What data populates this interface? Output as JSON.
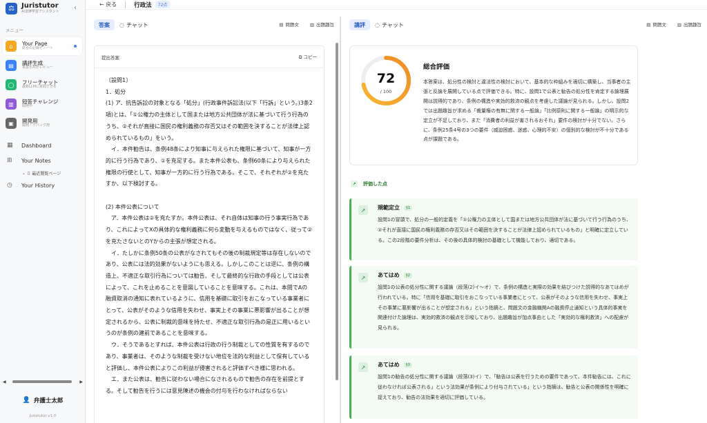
{
  "sidebar": {
    "brand": {
      "name": "Juristutor",
      "subtitle": "AI法律学習アシスタント"
    },
    "menu_label": "メニュー",
    "items": [
      {
        "title": "Your Page",
        "subtitle": "総合の記録とノート",
        "color": "#f5a623",
        "icon": "home-icon",
        "glyph": "⌂"
      },
      {
        "title": "講評生成",
        "subtitle": "答案をAIがレビュー",
        "color": "#3b82f6",
        "icon": "document-icon",
        "glyph": "▤"
      },
      {
        "title": "フリーチャット",
        "subtitle": "最新LLMに質問できる",
        "color": "#22b573",
        "icon": "chat-icon",
        "glyph": "◯"
      },
      {
        "title": "短答チャレンジ",
        "subtitle": "開発中",
        "color": "#8e5bd4",
        "icon": "book-icon",
        "glyph": "▥"
      },
      {
        "title": "開発用",
        "subtitle": "開発・デバッグ用",
        "color": "#666666",
        "icon": "terminal-icon",
        "glyph": "▣"
      }
    ],
    "links": {
      "dashboard": "Dashboard",
      "notes": "Your Notes",
      "recent_page": "最近閲覧ページ",
      "history": "Your History"
    },
    "user_name": "弁護士太郎",
    "version": "Juristutor v1.0"
  },
  "topbar": {
    "back": "戻る",
    "title": "行政法",
    "badge": "72点"
  },
  "left_panel": {
    "tab_answer": "答案",
    "tab_chat": "チャット",
    "question_text": "問題文",
    "intent": "出題趣旨",
    "card_title": "提出答案",
    "copy": "コピー",
    "paragraphs": [
      "〔設問1〕",
      "1．処分",
      "(1) ア．抗告訴訟の対象となる「処分」(行政事件訴訟法(以下「行訴」という。)3条2項)とは、「①公権力の主体として国または地方公共団体が法に基づいて行う行為のうち、②それが直接に国民の権利義務の存否又はその範囲を決することが法律上認められているもの」をいう。",
      "　イ．本件勧告は、条例48条により知事に与えられた権限に基づいて、知事が一方的に行う行為であり、①を充足する。また本件公表も、条例60条により与えられた権限の行使として、知事が一方的に行う行為である。そこで、それぞれが②を充たすか、以下検討する。",
      "",
      "(2) 本件公表について",
      "　ア．本件公表は②を充たすか。本件公表は、それ自体は知事の行う事実行為であり、これによってXの具体的な権利義務に何ら変動を与えるものではなく、従って②を充たさないとのYからの主張が想定される。",
      "　イ．たしかに条例50条の公表がなされてもその後の制裁規定等は存在しないのであり、公表には法的効果がないようにも思える。しかしこのことは逆に、条例の構造上、不適正な取引行為については勧告、そして最終的な行政の手段としては公表によって、これを止めることを意図していることを意味する。これは、本問でAの融資取消の通知に表れているように、信用を基礎に取引をおこなっている事業者にとって、公表がそのような信用を失わせ、事実上その事業に悪影響が出ることが想定されるから、公表に制裁的意味を持たせ、不適正な取引行為の是正に用いるというのが条例の建前であることを意味する。",
      "　ウ．そうであるとすれば、本件公表は行政の行う制裁としての性質を有するのであり、事業者は、そのような制裁を受けない地位を法的な利益として保有していると評価し、本件公表によりこの利益が侵害されると評価すべき様に思われる。",
      "　エ．また公表は、勧告に従わない場合になされるもので勧告の存在を前提とする。そして勧告を行うには意見陳述の機会の付与を行わなければならない"
    ]
  },
  "right_panel": {
    "tab_review": "講評",
    "tab_chat": "チャット",
    "question_text": "問題文",
    "intent": "出題趣旨",
    "score": 72,
    "score_max": "/ 100",
    "summary_title": "総合評価",
    "summary_text": "本答案は、処分性の検討と違法性の検討において、基本的な枠組みを適切に構築し、当事者の主張と反論を展開している点で評価できる。特に、設問1で公表と勧告の処分性を肯定する論理展開は説得的であり、条例の構造や実効的救済の観点を考慮した議論が見られる。しかし、設問2では出題趣旨が求める「裁量権の有無に関する一般論」「比例原則に関する一般論」の明示的な定立が不足しており、また「消費者の利益が害されるおそれ」要件の検討が十分でない。さらに、条例25条4号の3つの要件（威迫困惑、迷惑、心理的不安）の個別的な検討が不十分である点が課題である。",
    "good_heading": "評価した点",
    "good_points": [
      {
        "title": "規範定立",
        "badge": "§1",
        "text": "設問1の冒頭で、処分の一般的定義を「①公権力の主体として国または地方公共団体が法に基づいて行う行為のうち、②それが直接に国民の権利義務の存否又はその範囲を決することが法律上認められているもの」と明確に定立している。この2段階の要件分析は、その後の具体的検討の基礎として機能しており、適切である。"
      },
      {
        "title": "あてはめ",
        "badge": "§2",
        "text": "設問1の公表の処分性に関する議論（段落(2)イ〜オ）で、条例の構造と実際の効果を結びつけた説得的なあてはめが行われている。特に「信用を基礎に取引をおこなっている事業者にとって、公表がそのような信用を失わせ、事実上その事業に悪影響が出ることが想定される」という指摘と、問題文の金融機関Aの融資停止通知という具体的事実を関連付けた論理は、実効的救済の観点を示唆しており、出題趣旨が加点事由とした「実効的な権利救済」への配慮が見られる。"
      },
      {
        "title": "あてはめ",
        "badge": "§3",
        "text": "設問1の勧告の処分性に関する議論（段落(3)イ）で、「勧告は公表を行うための要件であって、本件勧告には、これに従わなければ公表される」という法効果が条例により付与されている」という指摘は、勧告と公表の関係性を明確に捉えており、勧告の法効果を適切に評価している。"
      }
    ]
  }
}
